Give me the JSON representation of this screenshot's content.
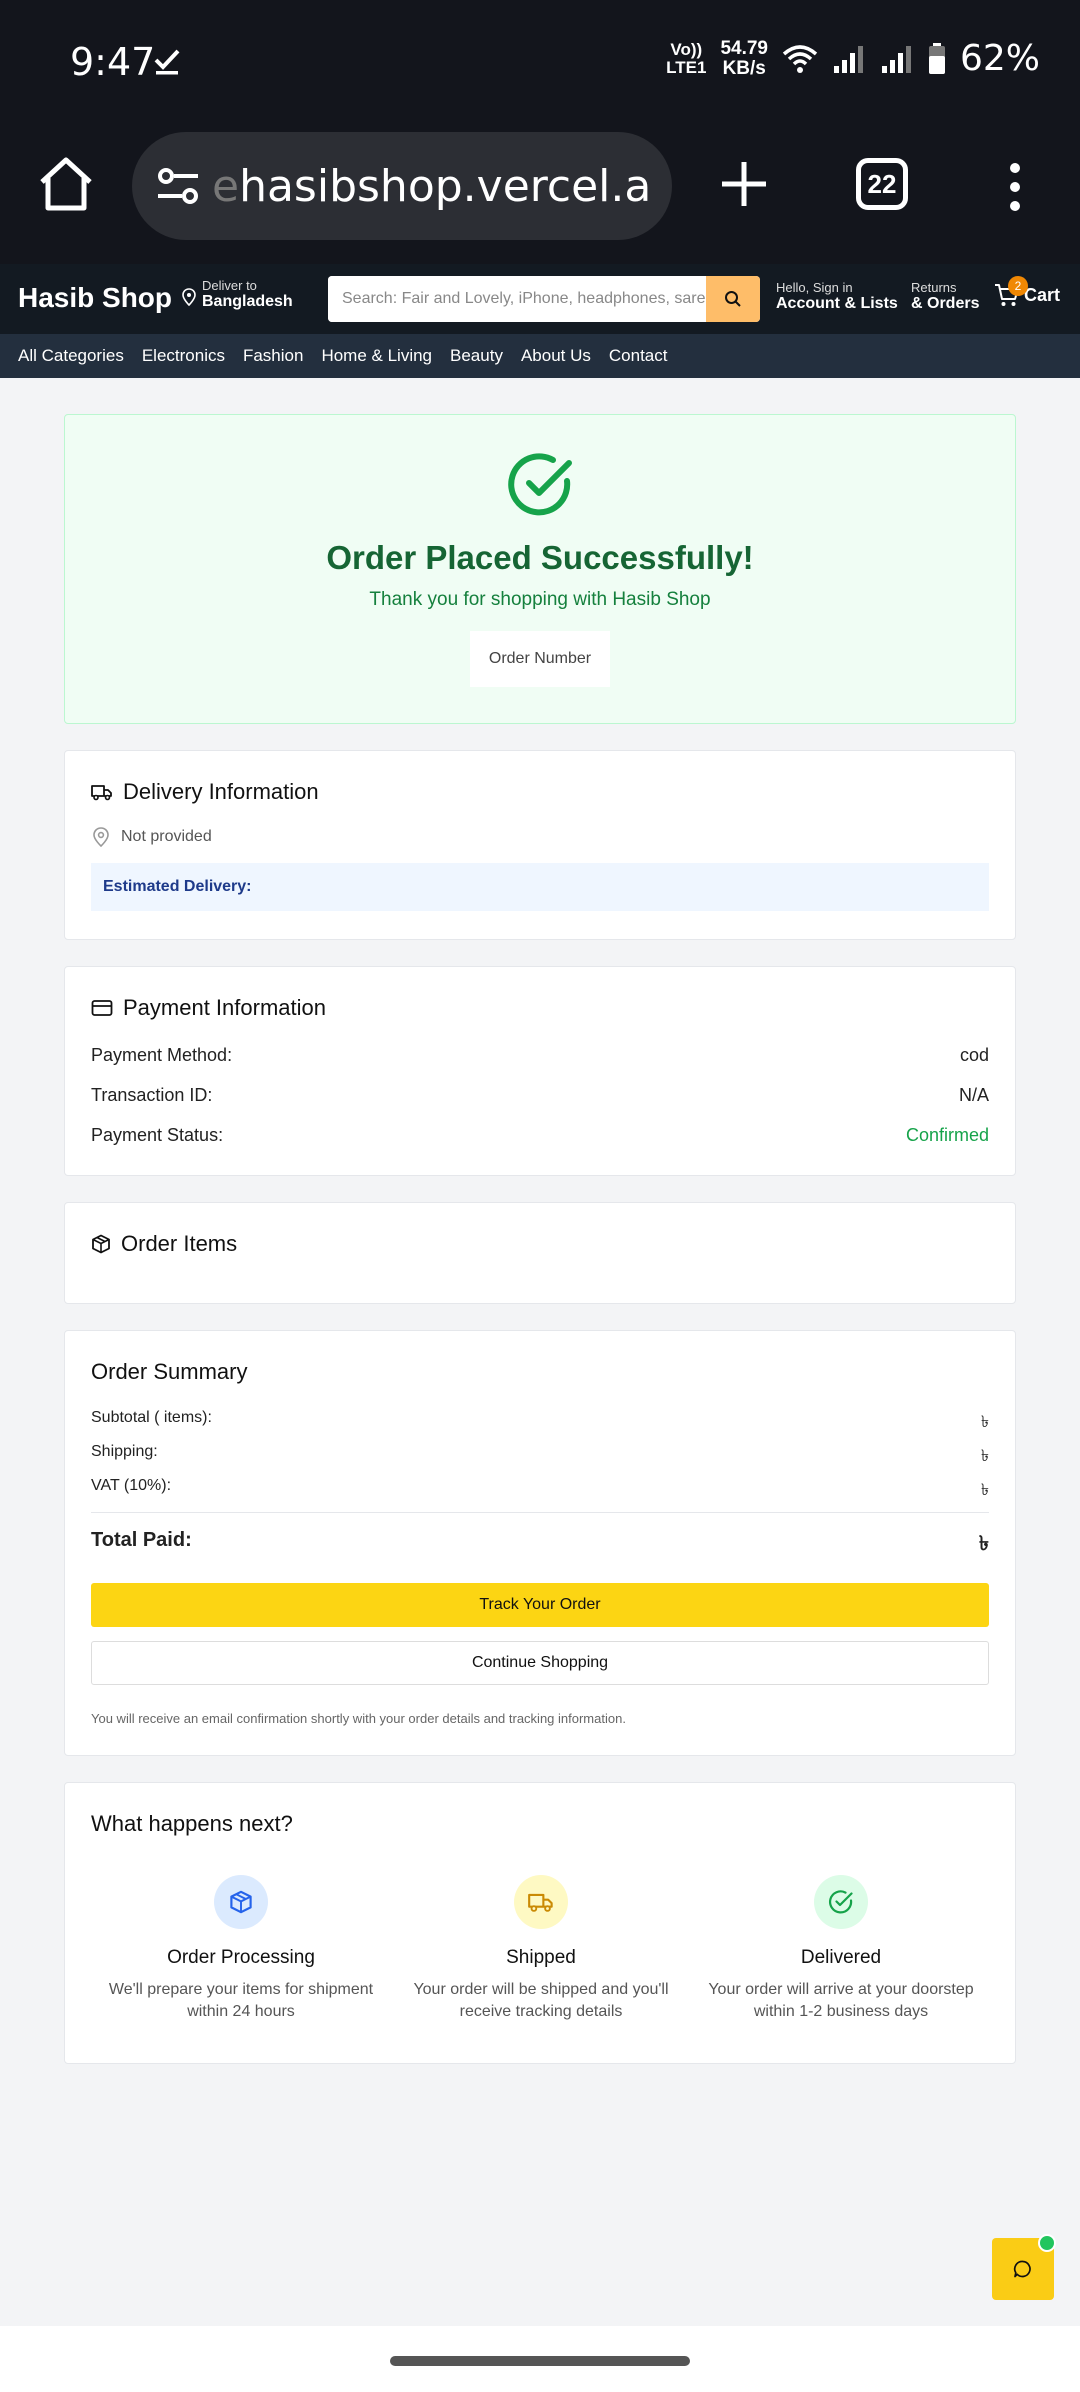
{
  "status_bar": {
    "time": "9:47",
    "network_label_1": "Vo))",
    "network_label_2": "LTE1",
    "speed_value": "54.79",
    "speed_unit": "KB/s",
    "battery": "62%"
  },
  "browser": {
    "url_faded": "e",
    "url": "hasibshop.vercel.app",
    "tab_count": "22"
  },
  "header": {
    "logo": "Hasib Shop",
    "deliver_label": "Deliver to",
    "deliver_location": "Bangladesh",
    "search_placeholder": "Search: Fair and Lovely, iPhone, headphones, saree...",
    "account_small": "Hello, Sign in",
    "account_big": "Account & Lists",
    "returns_small": "Returns",
    "returns_big": "& Orders",
    "cart_count": "2",
    "cart_label": "Cart"
  },
  "nav": {
    "items": [
      "All Categories",
      "Electronics",
      "Fashion",
      "Home & Living",
      "Beauty",
      "About Us",
      "Contact"
    ]
  },
  "success": {
    "title": "Order Placed Successfully!",
    "subtitle": "Thank you for shopping with Hasib Shop",
    "order_number_label": "Order Number"
  },
  "delivery": {
    "title": "Delivery Information",
    "address": "Not provided",
    "estimated_label": "Estimated Delivery:"
  },
  "payment": {
    "title": "Payment Information",
    "rows": [
      {
        "label": "Payment Method:",
        "value": "cod"
      },
      {
        "label": "Transaction ID:",
        "value": "N/A"
      },
      {
        "label": "Payment Status:",
        "value": "Confirmed"
      }
    ]
  },
  "order_items": {
    "title": "Order Items"
  },
  "summary": {
    "title": "Order Summary",
    "rows": [
      {
        "label": "Subtotal ( items):",
        "value": "৳"
      },
      {
        "label": "Shipping:",
        "value": "৳"
      },
      {
        "label": "VAT (10%):",
        "value": "৳"
      }
    ],
    "total_label": "Total Paid:",
    "total_value": "৳",
    "track_button": "Track Your Order",
    "continue_button": "Continue Shopping",
    "email_note": "You will receive an email confirmation shortly with your order details and tracking information."
  },
  "next": {
    "title": "What happens next?",
    "steps": [
      {
        "title": "Order Processing",
        "desc": "We'll prepare your items for shipment within 24 hours",
        "icon": "package-icon",
        "bg": "#dbeafe",
        "color": "#2563eb"
      },
      {
        "title": "Shipped",
        "desc": "Your order will be shipped and you'll receive tracking details",
        "icon": "truck-icon",
        "bg": "#fef9c3",
        "color": "#ca8a04"
      },
      {
        "title": "Delivered",
        "desc": "Your order will arrive at your doorstep within 1-2 business days",
        "icon": "check-circle-icon",
        "bg": "#dcfce7",
        "color": "#16a34a"
      }
    ]
  },
  "colors": {
    "success_green": "#16a34a",
    "track_yellow": "#fcd513",
    "header_dark": "#131a22",
    "nav_dark": "#232f3e",
    "search_orange": "#febd69"
  }
}
